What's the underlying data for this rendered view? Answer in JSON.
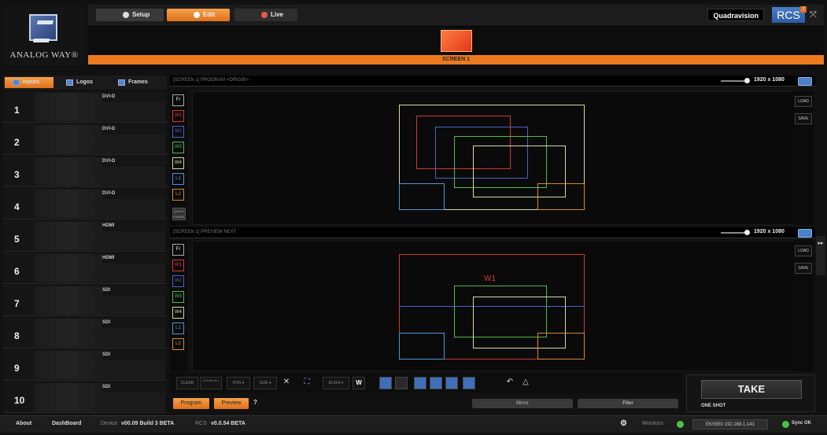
{
  "brand": {
    "logo_text": "ANALOG WAY®",
    "product_name": "Quadravision",
    "rcs_label": "RCS",
    "rcs_superscript": "2"
  },
  "mode_tabs": [
    {
      "label": "Setup",
      "active": false
    },
    {
      "label": "Edit",
      "active": true
    },
    {
      "label": "Live",
      "active": false
    }
  ],
  "screen": {
    "label": "SCREEN 1"
  },
  "left_tabs": [
    {
      "label": "Inputs",
      "active": true
    },
    {
      "label": "Logos",
      "active": false
    },
    {
      "label": "Frames",
      "active": false
    }
  ],
  "inputs": [
    {
      "number": "1",
      "type": "DVI-D"
    },
    {
      "number": "2",
      "type": "DVI-D"
    },
    {
      "number": "3",
      "type": "DVI-D"
    },
    {
      "number": "4",
      "type": "DVI-D"
    },
    {
      "number": "5",
      "type": "HDMI"
    },
    {
      "number": "6",
      "type": "HDMI"
    },
    {
      "number": "7",
      "type": "SDI"
    },
    {
      "number": "8",
      "type": "SDI"
    },
    {
      "number": "9",
      "type": "SDI"
    },
    {
      "number": "10",
      "type": "SDI"
    }
  ],
  "program_view": {
    "title": "[SCREEN 1] PROGRAM <ORIGIN>",
    "resolution": "1920 x 1080"
  },
  "preview_view": {
    "title": "[SCREEN 1] PREVIEW NEXT",
    "resolution": "1920 x 1080"
  },
  "layer_buttons": [
    "Fr",
    "W1",
    "W2",
    "W3",
    "W4",
    "L1",
    "L2"
  ],
  "quick_frame_label": "QUICK FRAME",
  "side_buttons": {
    "load": "LOAD",
    "save": "SAVE"
  },
  "preview_window_label": "W1",
  "toolbar": {
    "clear": "CLEAR",
    "clear_all": "CLEAR ALL",
    "pos": "POS ▾",
    "size": "SIZE ▾",
    "align": "ALIGN ▾",
    "w": "W"
  },
  "bottom": {
    "program": "Program",
    "preview": "Preview",
    "help": "?",
    "mirror": "Mirror",
    "filter": "Filter"
  },
  "take": {
    "label": "TAKE",
    "mode": "ONE SHOT"
  },
  "status": {
    "about": "About",
    "dashboard": "DashBoard",
    "device_label": "Device",
    "device_version": "v00.09 Build 3 BETA",
    "rcs_label": "RCS",
    "rcs_version": "v0.0.54 BETA",
    "monitors": "Monitors",
    "ip": "EKS550 192.168.1.141",
    "sync": "Sync OK"
  },
  "colors": {
    "accent": "#ec7a1d",
    "w1": "#d23a32",
    "w2": "#4e5fc7",
    "w3": "#51b84a",
    "w4": "#d9d9a0",
    "l1": "#4f95d6",
    "l2": "#d88a2e"
  }
}
